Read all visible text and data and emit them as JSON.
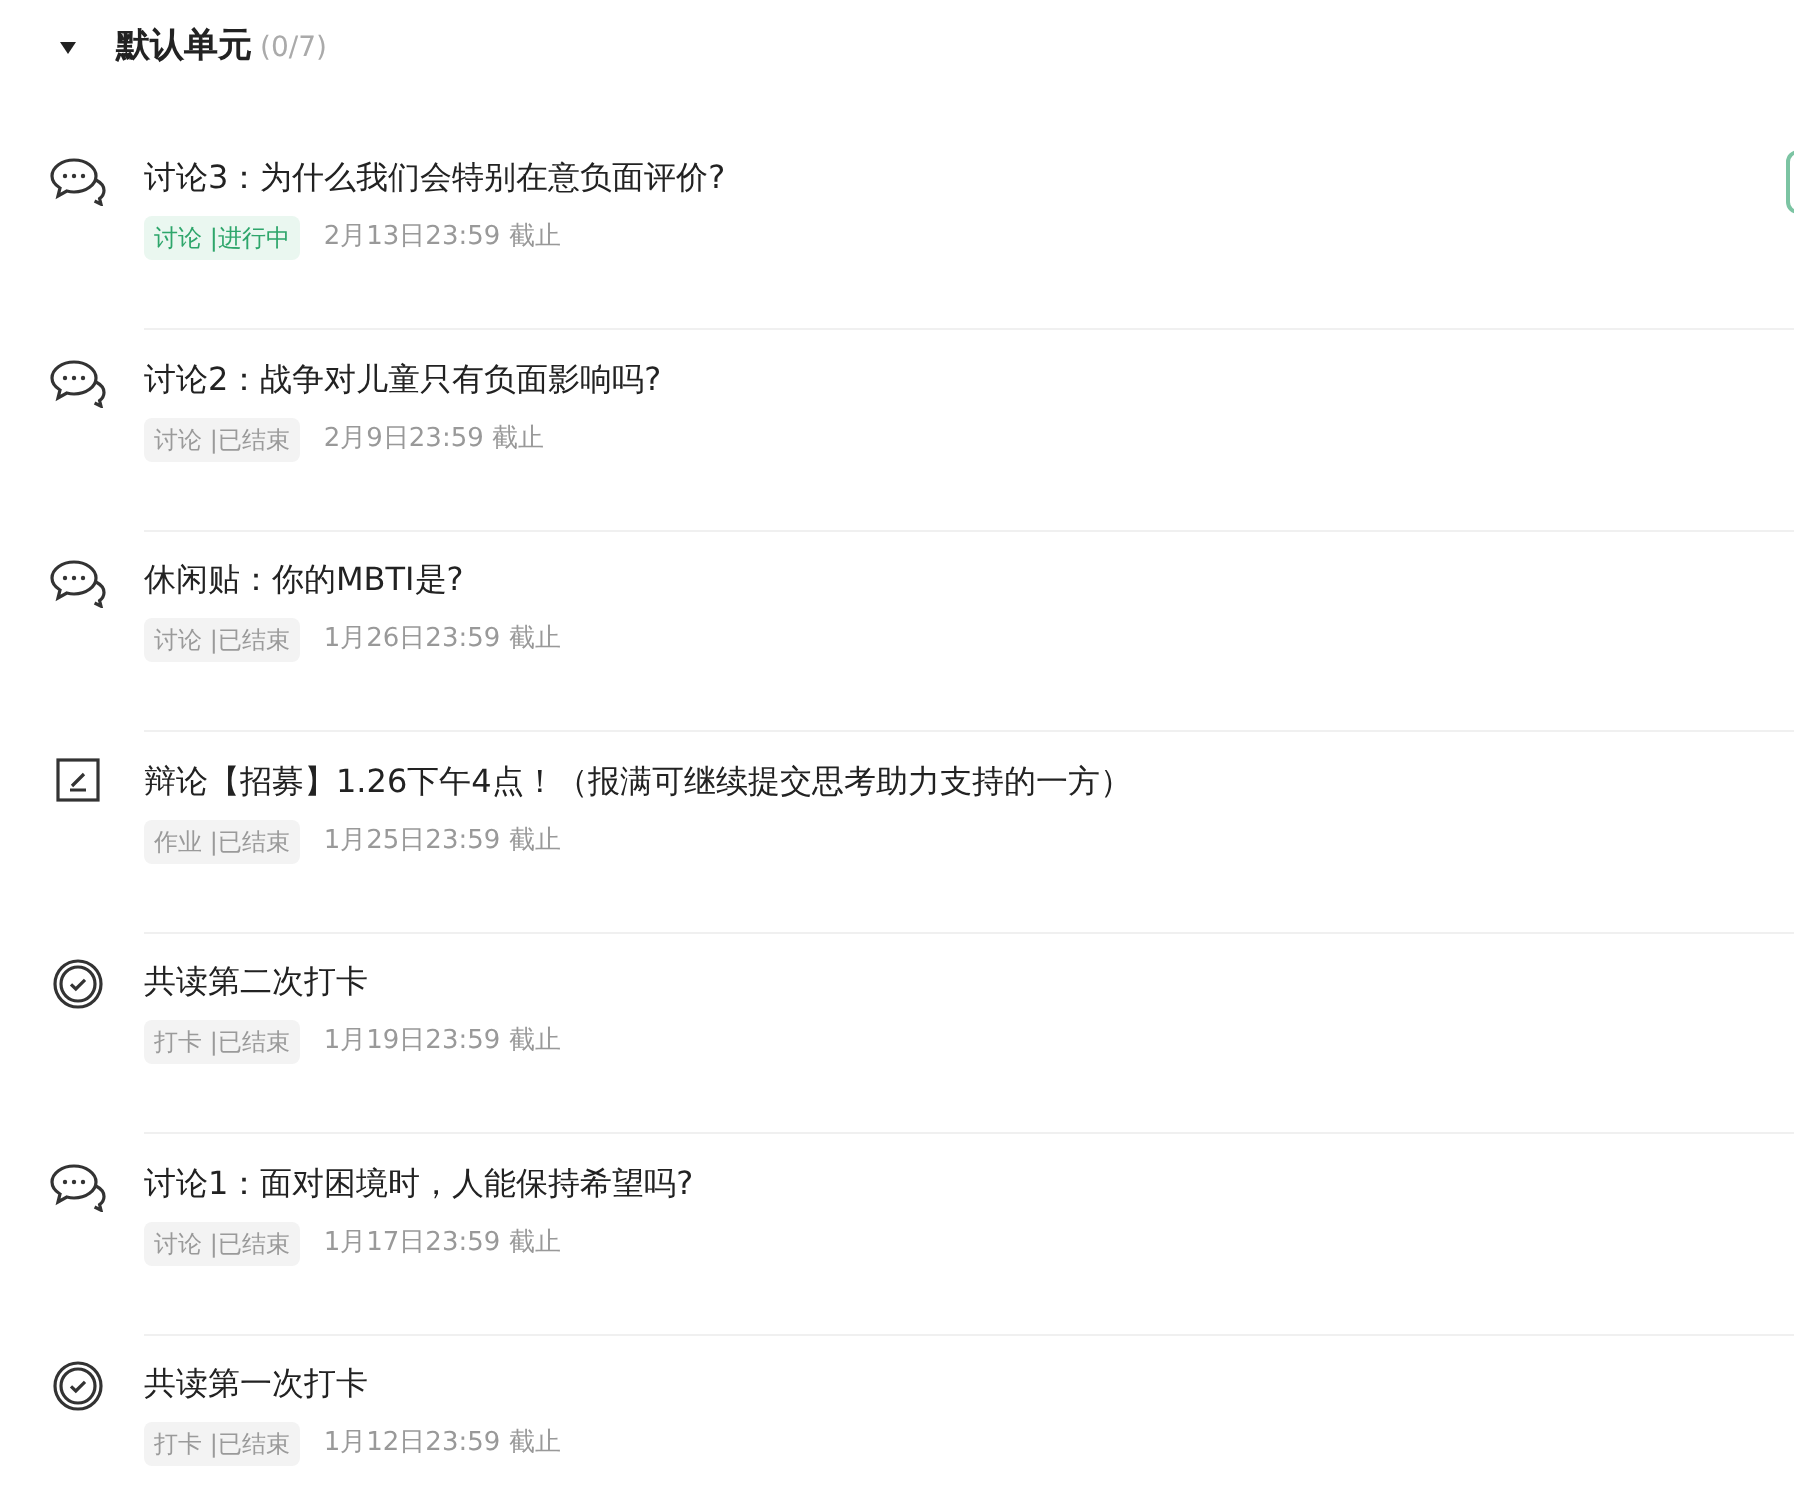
{
  "unit": {
    "title": "默认单元",
    "count": "(0/7)",
    "expanded": true
  },
  "items": [
    {
      "kind": "discussion",
      "title": "讨论3：为什么我们会特别在意负面评价?",
      "tag": "讨论 |进行中",
      "ongoing": true,
      "deadline": "2月13日23:59 截止",
      "has_action": true
    },
    {
      "kind": "discussion",
      "title": "讨论2：战争对儿童只有负面影响吗?",
      "tag": "讨论 |已结束",
      "ongoing": false,
      "deadline": "2月9日23:59 截止",
      "has_action": false
    },
    {
      "kind": "discussion",
      "title": "休闲贴：你的MBTI是?",
      "tag": "讨论 |已结束",
      "ongoing": false,
      "deadline": "1月26日23:59 截止",
      "has_action": false
    },
    {
      "kind": "assignment",
      "title": "辩论【招募】1.26下午4点！（报满可继续提交思考助力支持的一方）",
      "tag": "作业 |已结束",
      "ongoing": false,
      "deadline": "1月25日23:59 截止",
      "has_action": false
    },
    {
      "kind": "checkin",
      "title": "共读第二次打卡",
      "tag": "打卡 |已结束",
      "ongoing": false,
      "deadline": "1月19日23:59 截止",
      "has_action": false
    },
    {
      "kind": "discussion",
      "title": "讨论1：面对困境时，人能保持希望吗?",
      "tag": "讨论 |已结束",
      "ongoing": false,
      "deadline": "1月17日23:59 截止",
      "has_action": false
    },
    {
      "kind": "checkin",
      "title": "共读第一次打卡",
      "tag": "打卡 |已结束",
      "ongoing": false,
      "deadline": "1月12日23:59 截止",
      "has_action": false
    }
  ]
}
